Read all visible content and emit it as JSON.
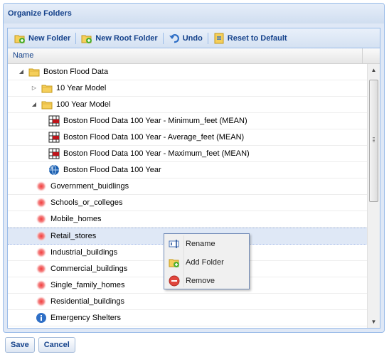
{
  "panel": {
    "title": "Organize Folders"
  },
  "toolbar": {
    "new_folder": "New Folder",
    "new_root_folder": "New Root Folder",
    "undo": "Undo",
    "reset": "Reset to Default"
  },
  "grid": {
    "column_name": "Name"
  },
  "rows": [
    {
      "label": "Boston Flood Data",
      "icon": "folder-icon",
      "expander": "expanded"
    },
    {
      "label": "10 Year Model",
      "icon": "folder-icon",
      "expander": "collapsed"
    },
    {
      "label": "100 Year Model",
      "icon": "folder-icon",
      "expander": "expanded"
    },
    {
      "label": "Boston Flood Data 100 Year - Minimum_feet (MEAN)",
      "icon": "grid-layer-icon"
    },
    {
      "label": "Boston Flood Data 100 Year - Average_feet (MEAN)",
      "icon": "grid-layer-icon"
    },
    {
      "label": "Boston Flood Data 100 Year - Maximum_feet (MEAN)",
      "icon": "grid-layer-icon"
    },
    {
      "label": "Boston Flood Data 100 Year",
      "icon": "globe-icon"
    },
    {
      "label": "Government_buidlings",
      "icon": "red-dot-icon"
    },
    {
      "label": "Schools_or_colleges",
      "icon": "red-dot-icon"
    },
    {
      "label": "Mobile_homes",
      "icon": "red-dot-icon"
    },
    {
      "label": "Retail_stores",
      "icon": "red-dot-icon"
    },
    {
      "label": "Industrial_buildings",
      "icon": "red-dot-icon"
    },
    {
      "label": "Commercial_buildings",
      "icon": "red-dot-icon"
    },
    {
      "label": "Single_family_homes",
      "icon": "red-dot-icon"
    },
    {
      "label": "Residential_buildings",
      "icon": "red-dot-icon"
    },
    {
      "label": "Emergency Shelters",
      "icon": "info-icon"
    }
  ],
  "context_menu": {
    "rename": "Rename",
    "add_folder": "Add Folder",
    "remove": "Remove"
  },
  "footer": {
    "save": "Save",
    "cancel": "Cancel"
  },
  "colors": {
    "accent": "#15428b",
    "border": "#99bbe8",
    "selection": "#dfe8f6"
  }
}
